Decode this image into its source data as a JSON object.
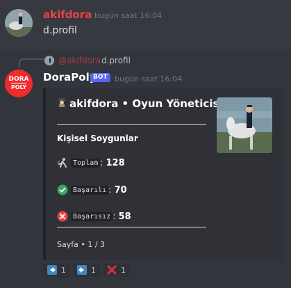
{
  "messages": [
    {
      "author": "akifdora",
      "timestamp": "bugün saat 16:04",
      "content": "d.profil"
    },
    {
      "reply": {
        "author": "@akifdora",
        "content": "d.profil"
      },
      "author": "DoraPoly",
      "bot_tag": "BOT",
      "timestamp": "bugün saat 16:04",
      "avatar_text": {
        "top": "DORA",
        "bottom": "POLY"
      },
      "embed": {
        "title": "akifdora • Oyun Yöneticisi",
        "title_emoji": "detective-emoji",
        "section_title": "Kişisel Soygunlar",
        "stats": [
          {
            "icon": "runner-icon",
            "label": "Toplam",
            "value": "128"
          },
          {
            "icon": "check-icon",
            "label": "Başarılı",
            "value": "70"
          },
          {
            "icon": "x-icon",
            "label": "Başarısız",
            "value": "58"
          }
        ],
        "footer": "Sayfa • 1 / 3"
      },
      "reactions": [
        {
          "icon": "arrow-left-icon",
          "count": "1"
        },
        {
          "icon": "arrow-right-icon",
          "count": "1"
        },
        {
          "icon": "cross-icon",
          "count": "1"
        }
      ]
    }
  ],
  "colors": {
    "background": "#36393f",
    "author_red": "#ed4245",
    "bot_tag": "#5865f2",
    "embed_bg": "#2f3136",
    "check_green": "#3ba55c",
    "x_red": "#ed4245",
    "arrow_blue": "#3b88c3"
  }
}
